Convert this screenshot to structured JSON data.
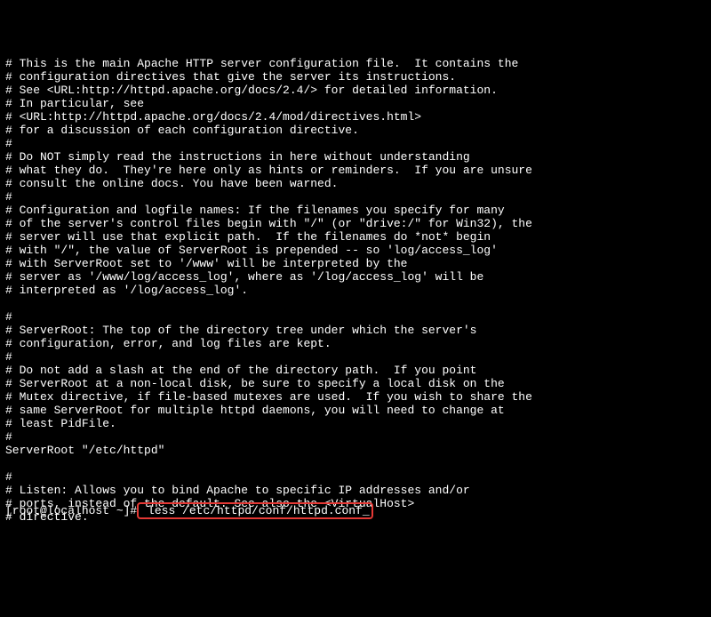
{
  "config_lines": [
    "# This is the main Apache HTTP server configuration file.  It contains the",
    "# configuration directives that give the server its instructions.",
    "# See <URL:http://httpd.apache.org/docs/2.4/> for detailed information.",
    "# In particular, see",
    "# <URL:http://httpd.apache.org/docs/2.4/mod/directives.html>",
    "# for a discussion of each configuration directive.",
    "#",
    "# Do NOT simply read the instructions in here without understanding",
    "# what they do.  They're here only as hints or reminders.  If you are unsure",
    "# consult the online docs. You have been warned.",
    "#",
    "# Configuration and logfile names: If the filenames you specify for many",
    "# of the server's control files begin with \"/\" (or \"drive:/\" for Win32), the",
    "# server will use that explicit path.  If the filenames do *not* begin",
    "# with \"/\", the value of ServerRoot is prepended -- so 'log/access_log'",
    "# with ServerRoot set to '/www' will be interpreted by the",
    "# server as '/www/log/access_log', where as '/log/access_log' will be",
    "# interpreted as '/log/access_log'.",
    "",
    "#",
    "# ServerRoot: The top of the directory tree under which the server's",
    "# configuration, error, and log files are kept.",
    "#",
    "# Do not add a slash at the end of the directory path.  If you point",
    "# ServerRoot at a non-local disk, be sure to specify a local disk on the",
    "# Mutex directive, if file-based mutexes are used.  If you wish to share the",
    "# same ServerRoot for multiple httpd daemons, you will need to change at",
    "# least PidFile.",
    "#",
    "ServerRoot \"/etc/httpd\"",
    "",
    "#",
    "# Listen: Allows you to bind Apache to specific IP addresses and/or",
    "# ports, instead of the default. See also the <VirtualHost>",
    "# directive."
  ],
  "prompt": {
    "user_host": "[root@localhost ~]#",
    "command": " less /etc/httpd/conf/httpd.conf",
    "cursor": "_"
  }
}
